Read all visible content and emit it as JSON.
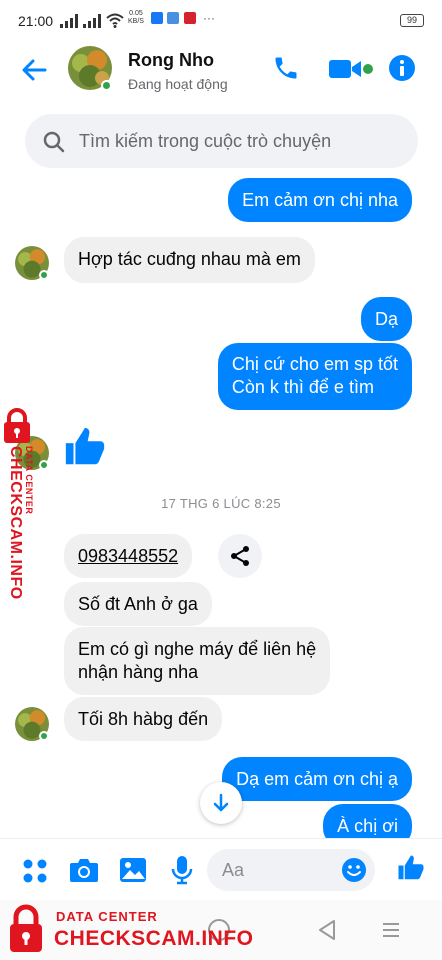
{
  "status_bar": {
    "time": "21:00",
    "net_speed_value": "0.05",
    "net_speed_unit": "KB/S",
    "more": "···",
    "battery": "99"
  },
  "header": {
    "name": "Rong Nho",
    "status": "Đang hoạt động",
    "accent_color": "#0084ff",
    "online_color": "#31a24c"
  },
  "search": {
    "placeholder": "Tìm kiếm trong cuộc trò chuyện"
  },
  "messages": [
    {
      "side": "out",
      "text": "Em cảm ơn chị nha"
    },
    {
      "side": "in",
      "text": "Hợp tác cuđng nhau mà em"
    },
    {
      "side": "out",
      "text": "Dạ"
    },
    {
      "side": "out",
      "lines": [
        "Chị cứ cho em sp tốt",
        "Còn k thì để e tìm"
      ]
    },
    {
      "side": "in",
      "type": "like",
      "icon": "thumbs-up-icon"
    },
    {
      "type": "timestamp",
      "text": "17 THG 6 LÚC 8:25"
    },
    {
      "side": "in",
      "text": "0983448552"
    },
    {
      "side": "in",
      "text": "Số đt Anh ở ga"
    },
    {
      "side": "in",
      "lines": [
        "Em có gì nghe máy để liên hệ",
        "nhận hàng nha"
      ]
    },
    {
      "side": "in",
      "text": "Tối 8h hàbg đến"
    },
    {
      "side": "out",
      "text": "Dạ em cảm ơn chị ạ"
    },
    {
      "side": "out",
      "text": "À chị ơi"
    }
  ],
  "composer": {
    "placeholder": "Aa"
  },
  "watermark": {
    "small": "DATA CENTER",
    "big": "CHECKSCAM.INFO",
    "color": "#e0151f"
  }
}
